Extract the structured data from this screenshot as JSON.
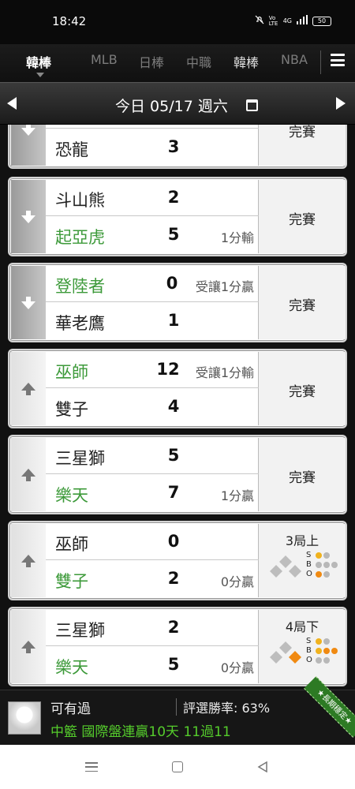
{
  "status_bar": {
    "time": "18:42",
    "battery": "50",
    "signal_label": "4G",
    "volte_label": "Vo LTE"
  },
  "league_tabs": {
    "items": [
      {
        "label": "韓棒",
        "active": true
      },
      {
        "label": "MLB",
        "active": false
      },
      {
        "label": "日棒",
        "active": false
      },
      {
        "label": "中職",
        "active": false
      },
      {
        "label": "韓棒",
        "active": false
      },
      {
        "label": "NBA",
        "active": false
      }
    ]
  },
  "date_bar": {
    "label": "今日 05/17 週六"
  },
  "games": [
    {
      "away": "",
      "away_score": "",
      "away_note": "",
      "home": "恐龍",
      "home_score": "3",
      "home_note": "",
      "status": "完賽",
      "side": "down"
    },
    {
      "away": "斗山熊",
      "away_score": "2",
      "away_note": "",
      "home": "起亞虎",
      "home_score": "5",
      "home_note": "1分輸",
      "status": "完賽",
      "side": "down"
    },
    {
      "away": "登陸者",
      "away_score": "0",
      "away_note": "受讓1分贏",
      "home": "華老鷹",
      "home_score": "1",
      "home_note": "",
      "status": "完賽",
      "side": "down"
    },
    {
      "away": "巫師",
      "away_score": "12",
      "away_note": "受讓1分輸",
      "home": "雙子",
      "home_score": "4",
      "home_note": "",
      "status": "完賽",
      "side": "up"
    },
    {
      "away": "三星獅",
      "away_score": "5",
      "away_note": "",
      "home": "樂天",
      "home_score": "7",
      "home_note": "1分贏",
      "status": "完賽",
      "side": "up"
    },
    {
      "away": "巫師",
      "away_score": "0",
      "away_note": "",
      "home": "雙子",
      "home_score": "2",
      "home_note": "0分贏",
      "status": "3局上",
      "side": "up"
    },
    {
      "away": "三星獅",
      "away_score": "2",
      "away_note": "",
      "home": "樂天",
      "home_score": "5",
      "home_note": "0分贏",
      "status": "4局下",
      "side": "up"
    }
  ],
  "sbo": {
    "s": "S",
    "b": "B",
    "o": "O"
  },
  "promo": {
    "user": "可有過",
    "win_rate": "評選勝率: 63%",
    "pick": "中籃 國際盤連贏10天 11過11",
    "ribbon": "★長期穩定★"
  },
  "colors": {
    "green_team": "#3d9a3a",
    "promo_green": "#55cc2c",
    "ball_yellow": "#f0b21e",
    "ball_orange": "#f08a12"
  }
}
